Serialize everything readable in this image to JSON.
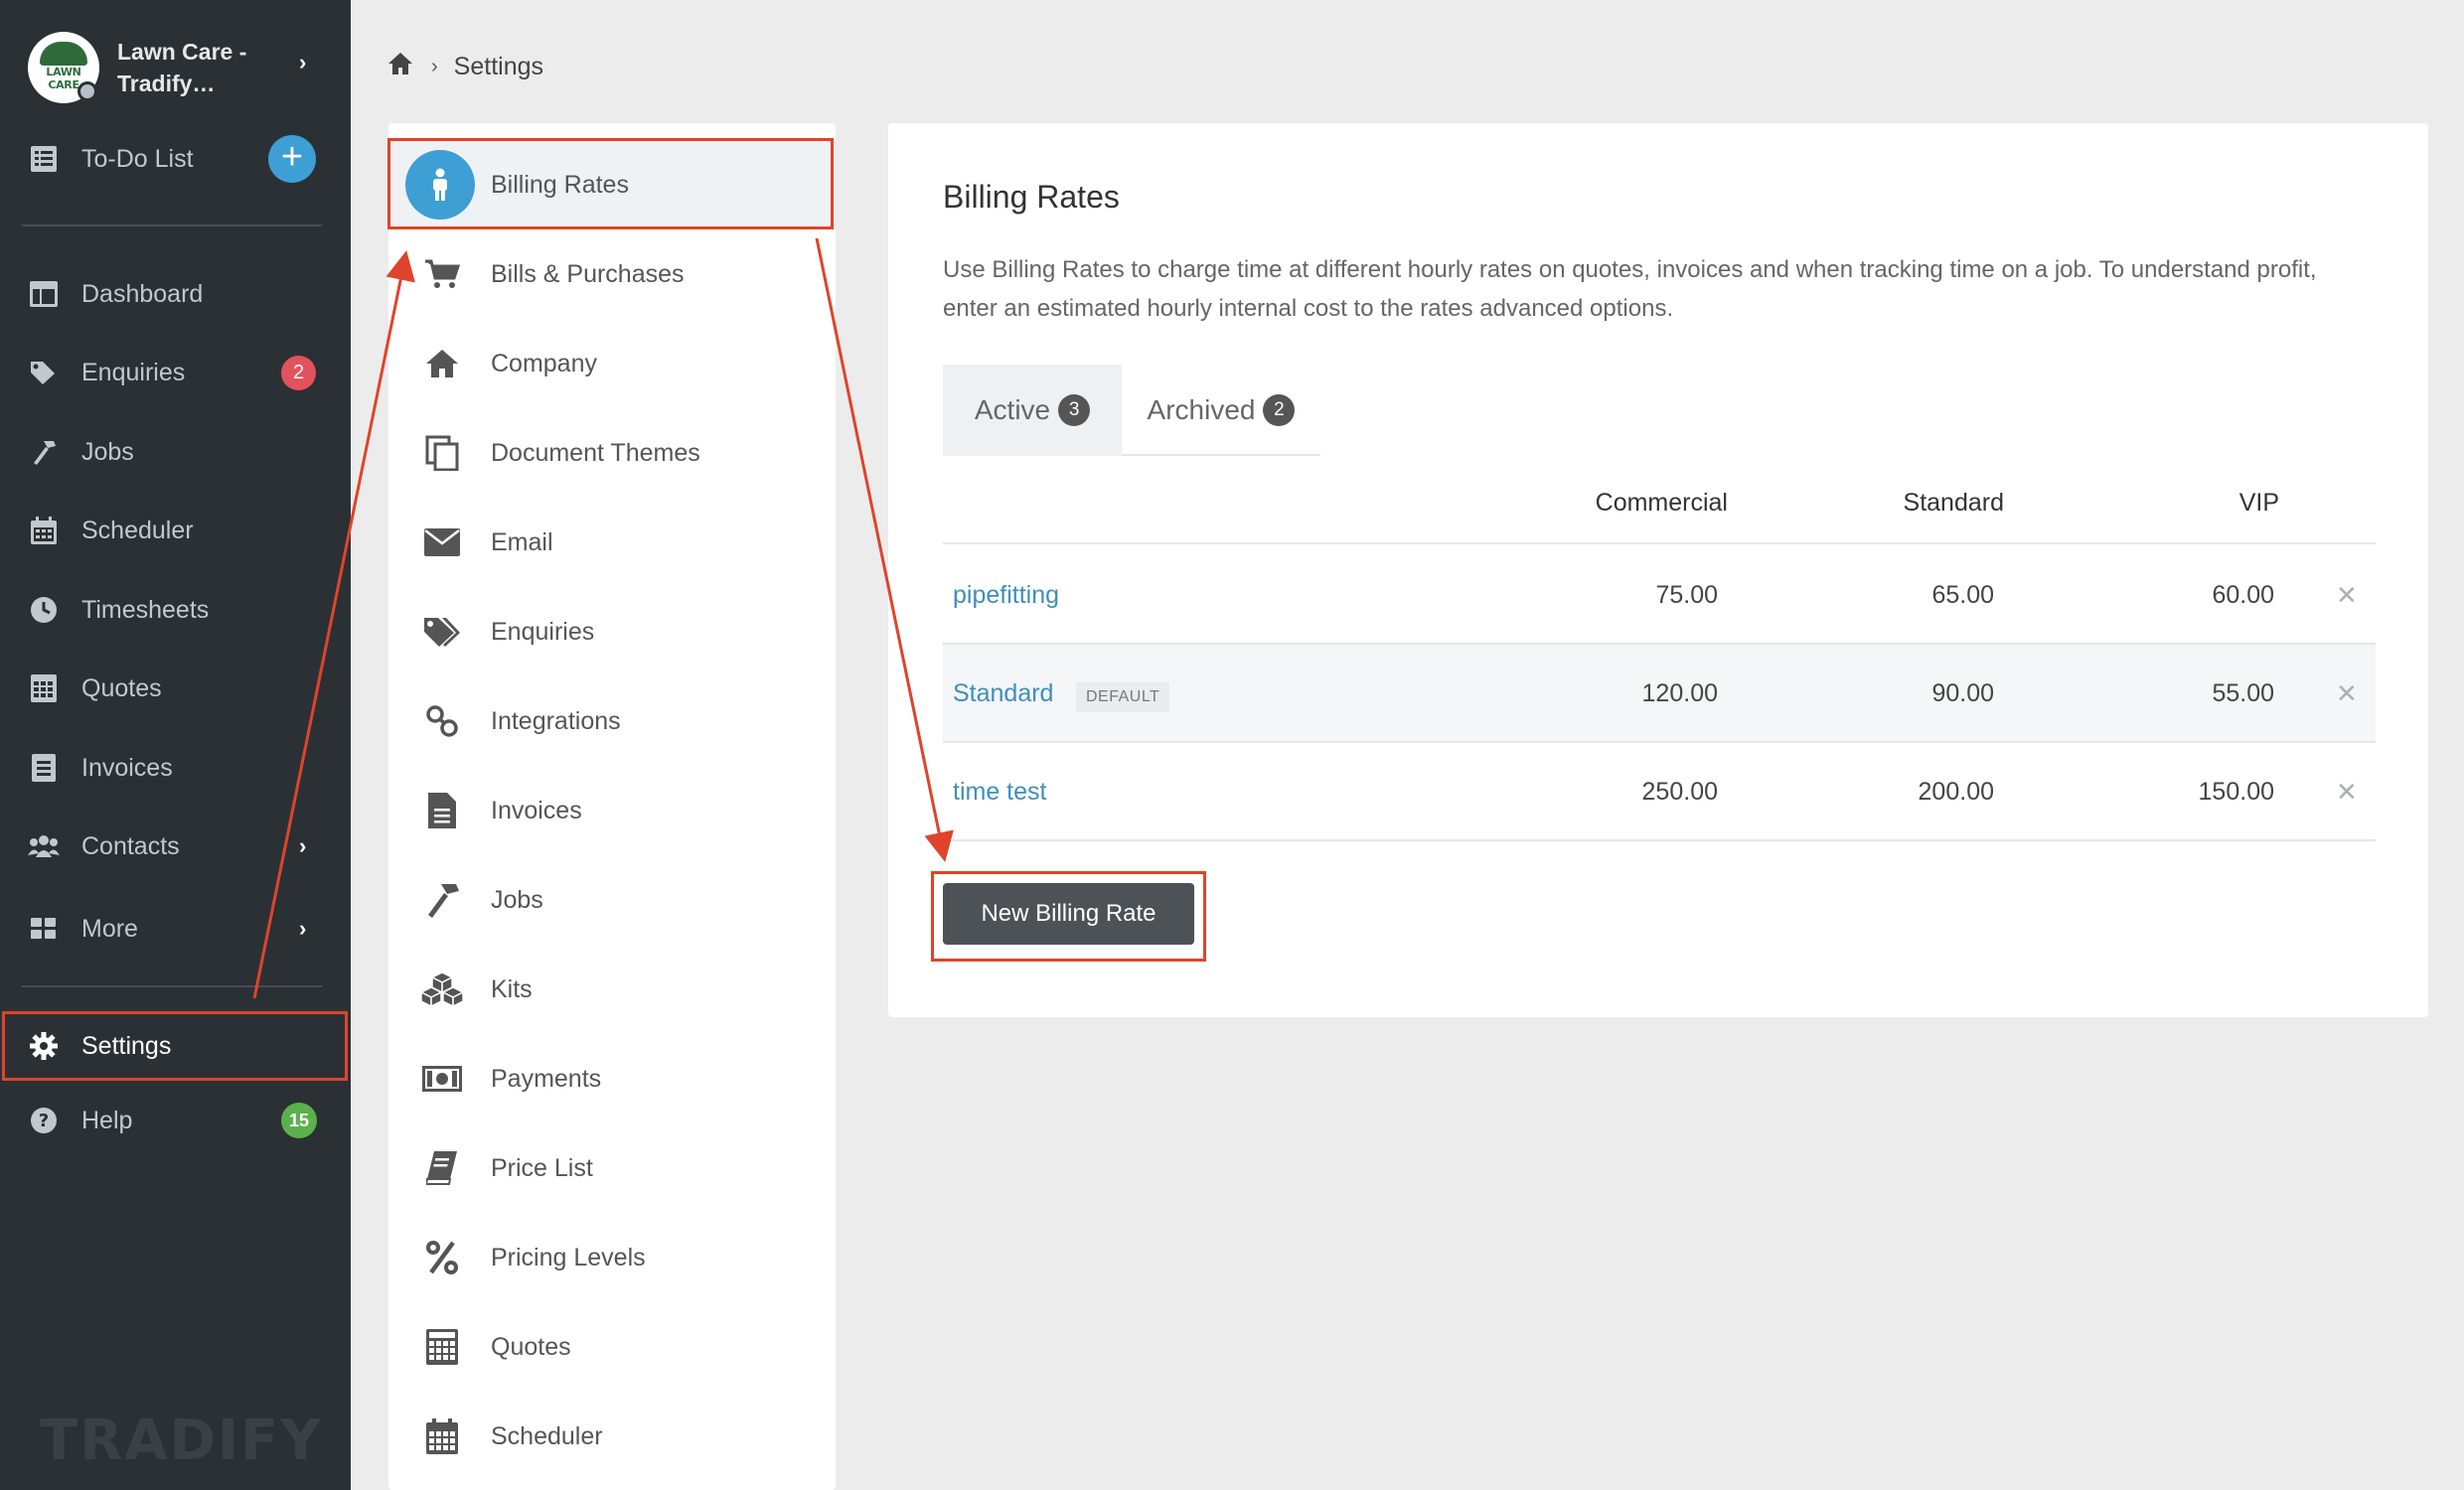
{
  "sidebar": {
    "company_name": "Lawn Care - Tradify…",
    "logo_text": "LAWN CARE",
    "todo_label": "To-Do List",
    "items": [
      {
        "label": "Dashboard",
        "icon": "dashboard-icon"
      },
      {
        "label": "Enquiries",
        "icon": "tags-icon",
        "badge": "2"
      },
      {
        "label": "Jobs",
        "icon": "hammer-icon"
      },
      {
        "label": "Scheduler",
        "icon": "calendar-icon"
      },
      {
        "label": "Timesheets",
        "icon": "clock-icon"
      },
      {
        "label": "Quotes",
        "icon": "calculator-icon"
      },
      {
        "label": "Invoices",
        "icon": "invoice-icon"
      },
      {
        "label": "Contacts",
        "icon": "users-icon"
      },
      {
        "label": "More",
        "icon": "grid-icon"
      },
      {
        "label": "Settings",
        "icon": "gear-icon"
      },
      {
        "label": "Help",
        "icon": "question-icon",
        "badge": "15"
      }
    ],
    "wordmark": "TRADIFY"
  },
  "breadcrumb": {
    "current": "Settings"
  },
  "settings_menu": [
    {
      "label": "Billing Rates",
      "icon": "person-icon",
      "active": true
    },
    {
      "label": "Bills & Purchases",
      "icon": "cart-icon"
    },
    {
      "label": "Company",
      "icon": "home-icon"
    },
    {
      "label": "Document Themes",
      "icon": "copy-icon"
    },
    {
      "label": "Email",
      "icon": "envelope-icon"
    },
    {
      "label": "Enquiries",
      "icon": "tags-icon"
    },
    {
      "label": "Integrations",
      "icon": "link-icon"
    },
    {
      "label": "Invoices",
      "icon": "file-icon"
    },
    {
      "label": "Jobs",
      "icon": "hammer-icon"
    },
    {
      "label": "Kits",
      "icon": "cubes-icon"
    },
    {
      "label": "Payments",
      "icon": "money-icon"
    },
    {
      "label": "Price List",
      "icon": "book-icon"
    },
    {
      "label": "Pricing Levels",
      "icon": "percent-icon"
    },
    {
      "label": "Quotes",
      "icon": "calculator-icon"
    },
    {
      "label": "Scheduler",
      "icon": "calendar-icon"
    }
  ],
  "main": {
    "title": "Billing Rates",
    "description": "Use Billing Rates to charge time at different hourly rates on quotes, invoices and when tracking time on a job. To understand profit, enter an estimated hourly internal cost to the rates advanced options.",
    "tabs": [
      {
        "label": "Active",
        "count": "3"
      },
      {
        "label": "Archived",
        "count": "2"
      }
    ],
    "columns": [
      "Commercial",
      "Standard",
      "VIP"
    ],
    "rows": [
      {
        "name": "pipefitting",
        "default_badge": "",
        "values": [
          "75.00",
          "65.00",
          "60.00"
        ]
      },
      {
        "name": "Standard",
        "default_badge": "DEFAULT",
        "values": [
          "120.00",
          "90.00",
          "55.00"
        ]
      },
      {
        "name": "time test",
        "default_badge": "",
        "values": [
          "250.00",
          "200.00",
          "150.00"
        ]
      }
    ],
    "delete_glyph": "✕",
    "new_button_label": "New Billing Rate"
  },
  "colors": {
    "sidebar_bg": "#2b3035",
    "accent_blue": "#3d9fd3",
    "highlight_red": "#e0432b",
    "badge_red": "#e2525c",
    "badge_green": "#5cb04c",
    "link_blue": "#3d8fbb"
  }
}
